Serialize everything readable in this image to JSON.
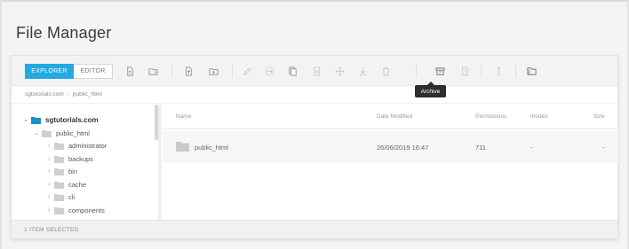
{
  "app": {
    "title": "File Manager"
  },
  "toolbar": {
    "modes": [
      {
        "label": "EXPLORER",
        "active": true
      },
      {
        "label": "EDITOR",
        "active": false
      }
    ],
    "accent_color": "#25a9e0",
    "icons": [
      "new-file-icon",
      "new-folder-icon",
      "upload-file-icon",
      "upload-folder-icon",
      "edit-icon",
      "move-icon",
      "copy-icon",
      "delete-icon",
      "drag-icon",
      "download-icon",
      "trash-icon",
      "archive-icon",
      "extract-icon",
      "permissions-icon",
      "folder-info-icon"
    ],
    "tooltip": "Archive"
  },
  "breadcrumb": {
    "items": [
      "sgtutorials.com",
      "public_html"
    ]
  },
  "tree": {
    "root": "sgtutorials.com",
    "child": "public_html",
    "folders": [
      "administrator",
      "backups",
      "bin",
      "cache",
      "cli",
      "components"
    ]
  },
  "list": {
    "columns": [
      "Name",
      "Date Modified",
      "Permissions",
      "Inodes",
      "Size"
    ],
    "rows": [
      {
        "name": "public_html",
        "date": "26/06/2019 16:47",
        "permissions": "711",
        "inodes": "-",
        "size": "-"
      }
    ]
  },
  "status": {
    "text": "1 ITEM SELECTED"
  }
}
